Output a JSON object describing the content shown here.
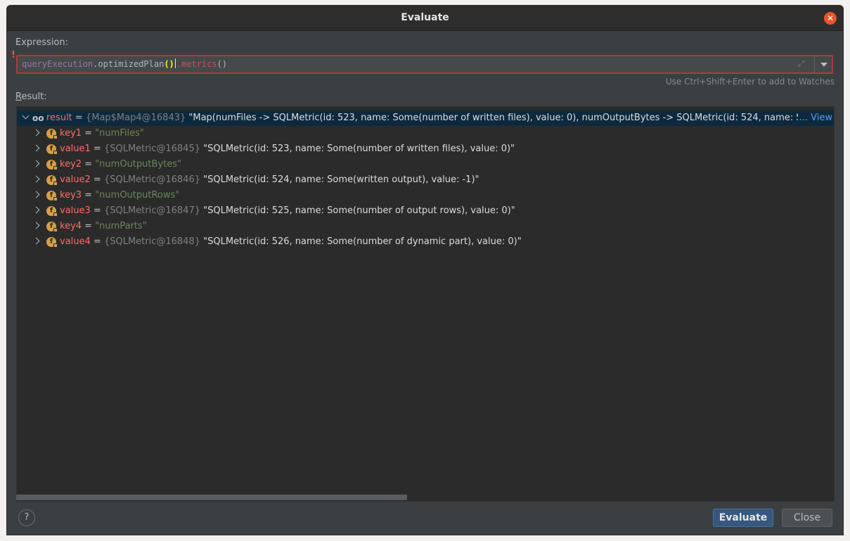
{
  "window": {
    "title": "Evaluate"
  },
  "expression": {
    "label": "Expression:",
    "part_receiver": "queryExecution",
    "dot1": ".",
    "method1": "optimizedPlan",
    "paren_open": "(",
    "paren_close": ")",
    "dot2": ".",
    "method2": "metrics",
    "paren2": "()",
    "hint": "Use Ctrl+Shift+Enter to add to Watches",
    "error_mark": "!"
  },
  "result": {
    "label": "Result:",
    "root": {
      "name": "result",
      "eq": " = ",
      "type_ref": "{Map$Map4@16843}",
      "to_string": " \"Map(numFiles -> SQLMetric(id: 523, name: Some(number of written files), value: 0), numOutputBytes -> SQLMetric(id: 524, name: S",
      "view_ellipsis": "... ",
      "view_label": "View"
    },
    "children": [
      {
        "name": "key1",
        "eq": " = ",
        "value": "\"numFiles\""
      },
      {
        "name": "value1",
        "eq": " = ",
        "type_ref": "{SQLMetric@16845}",
        "value": " \"SQLMetric(id: 523, name: Some(number of written files), value: 0)\""
      },
      {
        "name": "key2",
        "eq": " = ",
        "value": "\"numOutputBytes\""
      },
      {
        "name": "value2",
        "eq": " = ",
        "type_ref": "{SQLMetric@16846}",
        "value": " \"SQLMetric(id: 524, name: Some(written output), value: -1)\""
      },
      {
        "name": "key3",
        "eq": " = ",
        "value": "\"numOutputRows\""
      },
      {
        "name": "value3",
        "eq": " = ",
        "type_ref": "{SQLMetric@16847}",
        "value": " \"SQLMetric(id: 525, name: Some(number of output rows), value: 0)\""
      },
      {
        "name": "key4",
        "eq": " = ",
        "value": "\"numParts\""
      },
      {
        "name": "value4",
        "eq": " = ",
        "type_ref": "{SQLMetric@16848}",
        "value": " \"SQLMetric(id: 526, name: Some(number of dynamic part), value: 0)\""
      }
    ]
  },
  "buttons": {
    "help": "?",
    "evaluate": "Evaluate",
    "close": "Close"
  },
  "icons": {
    "close_window": "close-x-icon",
    "field": "field-f-icon",
    "watch": "glasses-icon",
    "expand": "expand-icon",
    "dropdown": "chevron-down-icon"
  },
  "colors": {
    "background": "#3c3f41",
    "panel": "#2b2b2b",
    "accent": "#365880",
    "error": "#b0393a",
    "close_red": "#e9542a"
  }
}
